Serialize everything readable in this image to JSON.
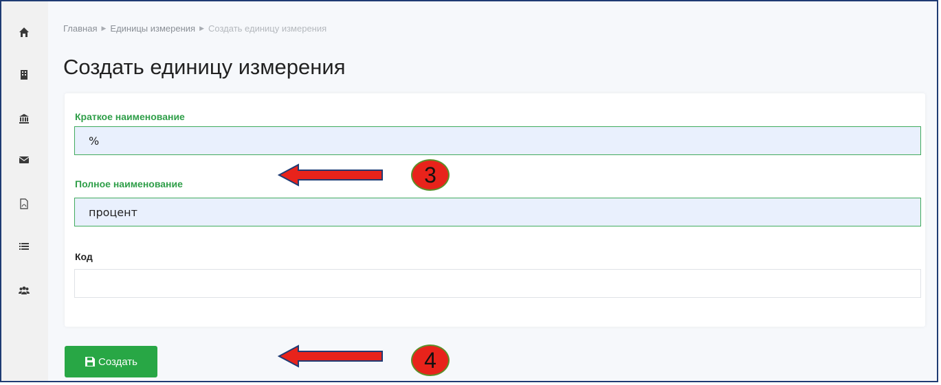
{
  "sidebar": {
    "icons": [
      {
        "name": "home-icon"
      },
      {
        "name": "building-icon"
      },
      {
        "name": "bank-icon"
      },
      {
        "name": "envelope-icon"
      },
      {
        "name": "pdf-icon"
      },
      {
        "name": "list-icon"
      },
      {
        "name": "users-icon"
      }
    ]
  },
  "breadcrumb": {
    "home": "Главная",
    "units": "Единицы измерения",
    "current": "Создать единицу измерения"
  },
  "page": {
    "title": "Создать единицу измерения"
  },
  "form": {
    "short_name": {
      "label": "Краткое наименование",
      "value": "%"
    },
    "full_name": {
      "label": "Полное наименование",
      "value": "процент"
    },
    "code": {
      "label": "Код",
      "value": ""
    }
  },
  "actions": {
    "create_label": "Создать"
  },
  "annotations": {
    "step3": "3",
    "step4": "4"
  },
  "colors": {
    "accent_green": "#28a745",
    "label_green": "#2e9e48",
    "annotation_red": "#e8231b",
    "frame_blue": "#1f3b73"
  }
}
